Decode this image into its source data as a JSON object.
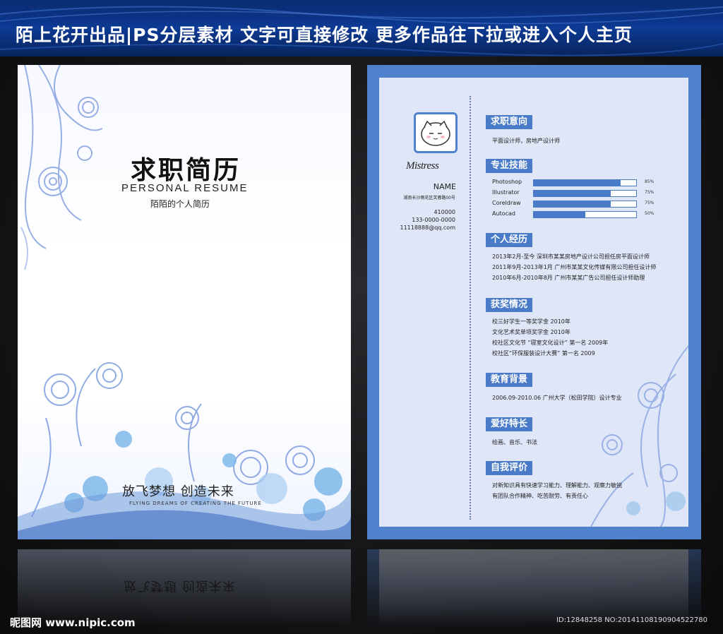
{
  "banner": {
    "text": "陌上花开出品|PS分层素材 文字可直接修改  更多作品往下拉或进入个人主页"
  },
  "cover": {
    "title": "求职简历",
    "subtitle_en": "PERSONAL RESUME",
    "subtitle_cn": "陌陌的个人简历",
    "slogan": "放飞梦想   创造未来",
    "slogan_en": "FLYING DREAMS OF CREATING THE FUTURE"
  },
  "profile": {
    "name_script": "Mistress",
    "name": "NAME",
    "address": "湖南长沙雨花区芙蓉路00号",
    "zip": "410000",
    "phone": "133-0000-0000",
    "email": "11118888@qq.com"
  },
  "sections": {
    "intention": {
      "title": "求职意向",
      "text": "平面设计师，房地产设计师"
    },
    "skills": {
      "title": "专业技能",
      "items": [
        {
          "name": "Photoshop",
          "percent_label": "85%",
          "level": 0.85
        },
        {
          "name": "Illustrator",
          "percent_label": "75%",
          "level": 0.75
        },
        {
          "name": "Coreldraw",
          "percent_label": "75%",
          "level": 0.75
        },
        {
          "name": "Autocad",
          "percent_label": "50%",
          "level": 0.5
        }
      ]
    },
    "experience": {
      "title": "个人经历",
      "lines": [
        "2013年2月-至今  深圳市某某房地产设计公司担任房平面设计师",
        "2011年9月-2013年1月  广州市某某文化传媒有限公司担任设计师",
        "2010年6月-2010年8月  广州市某某广告公司担任设计师助理"
      ]
    },
    "awards": {
      "title": "获奖情况",
      "lines": [
        "校三好学生一等奖学金   2010年",
        "文化艺术奖单项奖学金   2010年",
        "校社区文化节 “寝室文化设计” 第一名 2009年",
        "校社区“环保服装设计大赛” 第一名 2009"
      ]
    },
    "education": {
      "title": "教育背景",
      "text": "2006.09-2010.06 广州大学（松田学院）设计专业"
    },
    "hobbies": {
      "title": "爱好特长",
      "text": "绘画、音乐、书法"
    },
    "self_eval": {
      "title": "自我评价",
      "lines": [
        "对新知识具有快速学习能力、理解能力、观察力敏锐",
        "有团队合作精神、吃苦耐劳、有责任心"
      ]
    }
  },
  "watermark": {
    "left": "昵图网 www.nipic.com",
    "right": "ID:12848258 NO:20141108190904522780"
  },
  "colors": {
    "banner": "#0d3a94",
    "accent": "#4a7bc8",
    "frame": "#4f81cc",
    "resume_bg": "#dfe6f7"
  }
}
